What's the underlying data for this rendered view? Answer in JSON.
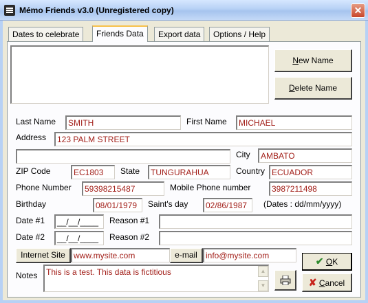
{
  "window": {
    "title": "Mémo Friends v3.0 (Unregistered copy)"
  },
  "tabs": [
    {
      "label": "Dates to celebrate"
    },
    {
      "label": "Friends Data"
    },
    {
      "label": "Export data"
    },
    {
      "label": "Options / Help"
    }
  ],
  "active_tab": "Friends Data",
  "buttons": {
    "new_name_pre": "",
    "new_name_u": "N",
    "new_name_post": "ew Name",
    "delete_name_pre": "",
    "delete_name_u": "D",
    "delete_name_post": "elete Name",
    "internet_site": "Internet Site",
    "email": "e-mail",
    "ok_u": "O",
    "ok_post": "K",
    "cancel_u": "C",
    "cancel_post": "ancel"
  },
  "labels": {
    "last_name": "Last Name",
    "first_name": "First Name",
    "address": "Address",
    "city": "City",
    "zip": "ZIP Code",
    "state": "State",
    "country": "Country",
    "phone": "Phone Number",
    "mobile": "Mobile Phone number",
    "birthday": "Birthday",
    "saints_day": "Saint's day",
    "date_format": "(Dates : dd/mm/yyyy)",
    "date1": "Date #1",
    "reason1": "Reason #1",
    "date2": "Date #2",
    "reason2": "Reason #2",
    "notes": "Notes"
  },
  "values": {
    "last_name": "SMITH",
    "first_name": "MICHAEL",
    "address1": "123 PALM STREET",
    "address2": "",
    "city": "AMBATO",
    "zip": "EC1803",
    "state": "TUNGURAHUA",
    "country": "ECUADOR",
    "phone": "59398215487",
    "mobile": "3987211498",
    "birthday": "08/01/1979",
    "saints_day": "02/86/1987",
    "date1": "__/__/____",
    "reason1": "",
    "date2": "__/__/____",
    "reason2": "",
    "internet_site": "www.mysite.com",
    "email": "info@mysite.com",
    "notes": "This is a test. This data is fictitious"
  },
  "icons": {
    "close": "close-icon",
    "print": "printer-icon",
    "ok": "checkmark-icon",
    "cancel": "x-icon"
  },
  "colors": {
    "value_text": "#A3211B",
    "ok_check": "#2E8B2E",
    "cancel_x": "#C8241C"
  }
}
